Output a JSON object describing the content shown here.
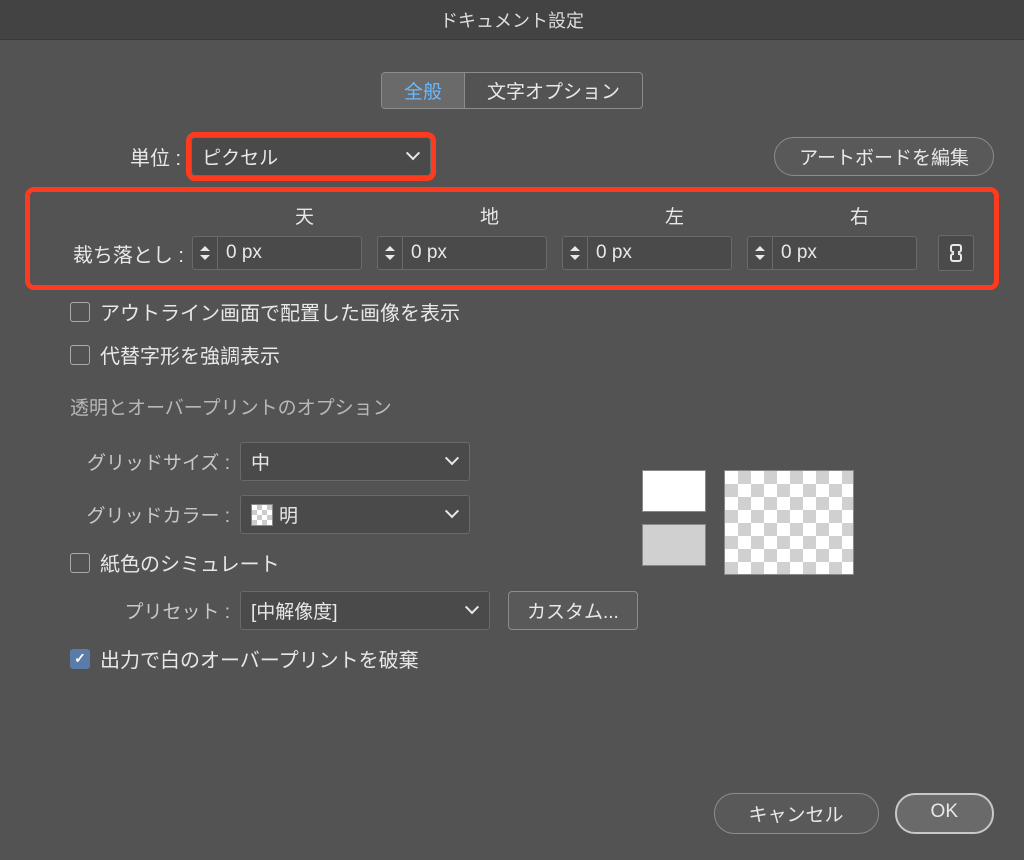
{
  "title": "ドキュメント設定",
  "tabs": {
    "general": "全般",
    "type": "文字オプション"
  },
  "units": {
    "label": "単位 :",
    "value": "ピクセル"
  },
  "editArtboards": "アートボードを編集",
  "bleed": {
    "label": "裁ち落とし :",
    "cols": {
      "top": "天",
      "bottom": "地",
      "left": "左",
      "right": "右"
    },
    "values": {
      "top": "0 px",
      "bottom": "0 px",
      "left": "0 px",
      "right": "0 px"
    }
  },
  "checks": {
    "outlineImages": "アウトライン画面で配置した画像を表示",
    "altGlyphs": "代替字形を強調表示",
    "simPaper": "紙色のシミュレート",
    "discardWhiteOP": "出力で白のオーバープリントを破棄"
  },
  "transSection": "透明とオーバープリントのオプション",
  "grid": {
    "sizeLabel": "グリッドサイズ :",
    "sizeValue": "中",
    "colorLabel": "グリッドカラー :",
    "colorValue": "明",
    "presetLabel": "プリセット :",
    "presetValue": "[中解像度]",
    "customBtn": "カスタム..."
  },
  "footer": {
    "cancel": "キャンセル",
    "ok": "OK"
  }
}
